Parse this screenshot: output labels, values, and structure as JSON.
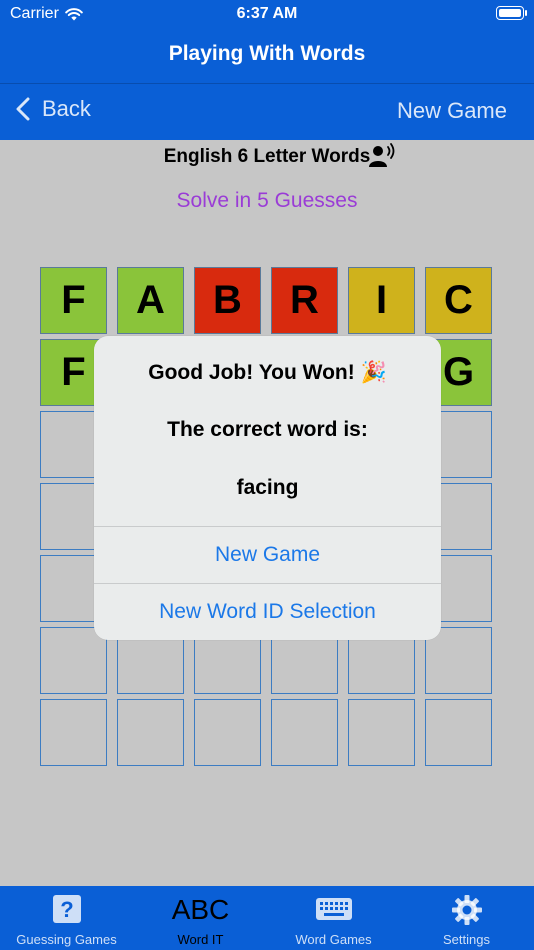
{
  "status_bar": {
    "carrier": "Carrier",
    "time": "6:37 AM"
  },
  "nav": {
    "title": "Playing With Words",
    "back_label": "Back",
    "new_game_label": "New Game"
  },
  "game": {
    "subtitle": "English 6 Letter Words",
    "guesses_label": "Solve in 5 Guesses",
    "colors": {
      "green": "#8ac43a",
      "red": "#d82a0e",
      "yellow": "#cfb21c"
    },
    "rows": [
      [
        {
          "letter": "F",
          "state": "green"
        },
        {
          "letter": "A",
          "state": "green"
        },
        {
          "letter": "B",
          "state": "red"
        },
        {
          "letter": "R",
          "state": "red"
        },
        {
          "letter": "I",
          "state": "yellow"
        },
        {
          "letter": "C",
          "state": "yellow"
        }
      ],
      [
        {
          "letter": "F",
          "state": "green"
        },
        {
          "letter": "",
          "state": "green"
        },
        {
          "letter": "",
          "state": "green"
        },
        {
          "letter": "",
          "state": "green"
        },
        {
          "letter": "",
          "state": "green"
        },
        {
          "letter": "G",
          "state": "green"
        }
      ],
      [
        {
          "letter": "",
          "state": "empty"
        },
        {
          "letter": "",
          "state": "empty"
        },
        {
          "letter": "",
          "state": "empty"
        },
        {
          "letter": "",
          "state": "empty"
        },
        {
          "letter": "",
          "state": "empty"
        },
        {
          "letter": "",
          "state": "empty"
        }
      ],
      [
        {
          "letter": "",
          "state": "empty"
        },
        {
          "letter": "",
          "state": "empty"
        },
        {
          "letter": "",
          "state": "empty"
        },
        {
          "letter": "",
          "state": "empty"
        },
        {
          "letter": "",
          "state": "empty"
        },
        {
          "letter": "",
          "state": "empty"
        }
      ],
      [
        {
          "letter": "",
          "state": "empty"
        },
        {
          "letter": "",
          "state": "empty"
        },
        {
          "letter": "",
          "state": "empty"
        },
        {
          "letter": "",
          "state": "empty"
        },
        {
          "letter": "",
          "state": "empty"
        },
        {
          "letter": "",
          "state": "empty"
        }
      ],
      [
        {
          "letter": "",
          "state": "empty"
        },
        {
          "letter": "",
          "state": "empty"
        },
        {
          "letter": "",
          "state": "empty"
        },
        {
          "letter": "",
          "state": "empty"
        },
        {
          "letter": "",
          "state": "empty"
        },
        {
          "letter": "",
          "state": "empty"
        }
      ],
      [
        {
          "letter": "",
          "state": "empty"
        },
        {
          "letter": "",
          "state": "empty"
        },
        {
          "letter": "",
          "state": "empty"
        },
        {
          "letter": "",
          "state": "empty"
        },
        {
          "letter": "",
          "state": "empty"
        },
        {
          "letter": "",
          "state": "empty"
        }
      ]
    ]
  },
  "alert": {
    "title": "Good Job! You Won! 🎉",
    "message": "The correct word is:",
    "word": "facing",
    "new_game_button": "New Game",
    "new_word_id_button": "New Word ID Selection"
  },
  "tabbar": {
    "items": [
      {
        "label": "Guessing Games",
        "icon": "question-icon"
      },
      {
        "label": "Word IT",
        "icon": "abc-icon",
        "glyph": "ABC",
        "selected": true
      },
      {
        "label": "Word Games",
        "icon": "keyboard-icon"
      },
      {
        "label": "Settings",
        "icon": "gear-icon"
      }
    ]
  }
}
